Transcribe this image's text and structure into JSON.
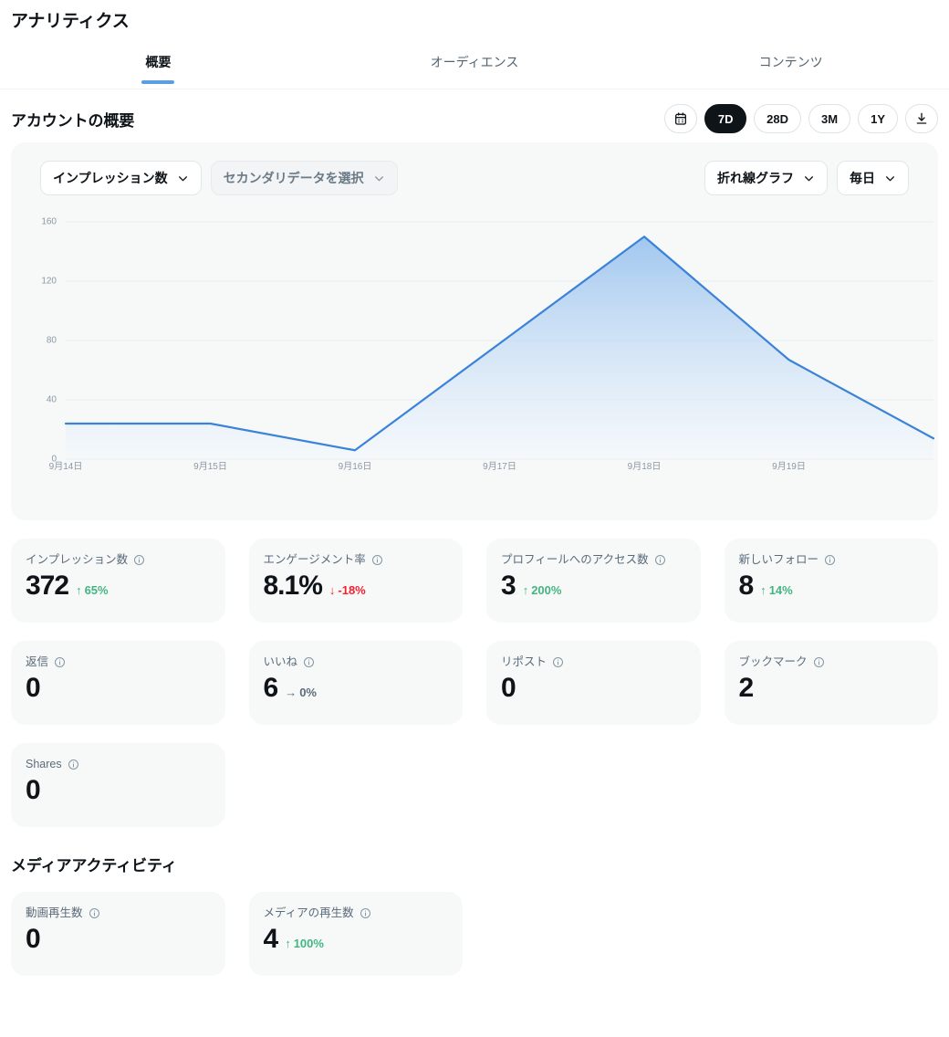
{
  "header": {
    "title": "アナリティクス",
    "tabs": [
      {
        "label": "概要",
        "active": true
      },
      {
        "label": "オーディエンス",
        "active": false
      },
      {
        "label": "コンテンツ",
        "active": false
      }
    ]
  },
  "overview": {
    "section_title": "アカウントの概要",
    "range_buttons": [
      {
        "label": "",
        "icon": "calendar-icon",
        "active": false
      },
      {
        "label": "7D",
        "icon": "",
        "active": true
      },
      {
        "label": "28D",
        "icon": "",
        "active": false
      },
      {
        "label": "3M",
        "icon": "",
        "active": false
      },
      {
        "label": "1Y",
        "icon": "",
        "active": false
      },
      {
        "label": "",
        "icon": "download-icon",
        "active": false
      }
    ]
  },
  "chart_controls": {
    "primary_metric": "インプレッション数",
    "secondary_metric": "セカンダリデータを選択",
    "chart_type": "折れ線グラフ",
    "granularity": "毎日"
  },
  "chart_data": {
    "type": "area",
    "title": "インプレッション数",
    "xlabel": "",
    "ylabel": "",
    "categories": [
      "9月14日",
      "9月15日",
      "9月16日",
      "9月17日",
      "9月18日",
      "9月19日",
      ""
    ],
    "x": [
      "9月14日",
      "9月15日",
      "9月16日",
      "9月17日",
      "9月18日",
      "9月19日",
      ""
    ],
    "values": [
      24,
      24,
      6,
      78,
      150,
      67,
      14
    ],
    "series": [
      {
        "name": "インプレッション数",
        "values": [
          24,
          24,
          6,
          78,
          150,
          67,
          14
        ]
      }
    ],
    "ylim": [
      0,
      160
    ],
    "yticks": [
      0,
      40,
      80,
      120,
      160
    ],
    "ytick_labels": [
      "0",
      "40",
      "80",
      "120",
      "160"
    ],
    "grid": true,
    "legend": "none",
    "line_color": "#3b82d9",
    "fill_top_color": "#9cc4ee",
    "fill_bottom_color": "#f2f7fc"
  },
  "metrics": [
    {
      "label": "インプレッション数",
      "value": "372",
      "delta": "65%",
      "direction": "up"
    },
    {
      "label": "エンゲージメント率",
      "value": "8.1%",
      "delta": "-18%",
      "direction": "down"
    },
    {
      "label": "プロフィールへのアクセス数",
      "value": "3",
      "delta": "200%",
      "direction": "up"
    },
    {
      "label": "新しいフォロー",
      "value": "8",
      "delta": "14%",
      "direction": "up"
    },
    {
      "label": "返信",
      "value": "0",
      "delta": "",
      "direction": "none"
    },
    {
      "label": "いいね",
      "value": "6",
      "delta": "0%",
      "direction": "flat"
    },
    {
      "label": "リポスト",
      "value": "0",
      "delta": "",
      "direction": "none"
    },
    {
      "label": "ブックマーク",
      "value": "2",
      "delta": "",
      "direction": "none"
    },
    {
      "label": "Shares",
      "value": "0",
      "delta": "",
      "direction": "none"
    }
  ],
  "media": {
    "section_title": "メディアアクティビティ",
    "metrics": [
      {
        "label": "動画再生数",
        "value": "0",
        "delta": "",
        "direction": "none"
      },
      {
        "label": "メディアの再生数",
        "value": "4",
        "delta": "100%",
        "direction": "up"
      }
    ]
  },
  "colors": {
    "accent_blue": "#5a9fe0",
    "positive": "#43b581",
    "negative": "#f4212e",
    "neutral": "#5b6b7a",
    "card_bg": "#f7f9f9",
    "text_primary": "#0f1419",
    "text_secondary": "#536471"
  }
}
